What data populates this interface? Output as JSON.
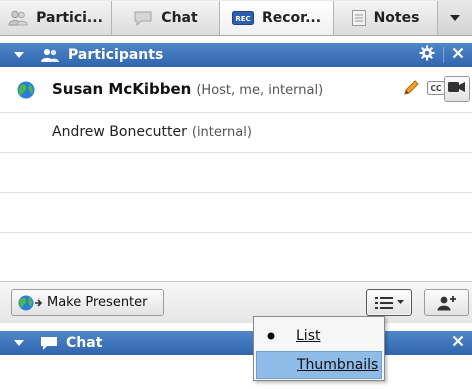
{
  "tabs": [
    {
      "label": "Partici...",
      "icon": "participants-icon"
    },
    {
      "label": "Chat",
      "icon": "chat-icon"
    },
    {
      "label": "Recor...",
      "icon": "record-icon"
    },
    {
      "label": "Notes",
      "icon": "notes-icon"
    }
  ],
  "participants_panel": {
    "title": "Participants"
  },
  "participants": [
    {
      "name": "Susan McKibben",
      "role": "(Host, me, internal)",
      "presenter": true
    },
    {
      "name": "Andrew Bonecutter",
      "role": "(internal)",
      "presenter": false
    }
  ],
  "toolbar": {
    "make_presenter_label": "Make Presenter"
  },
  "chat_panel": {
    "title": "Chat"
  },
  "view_menu": {
    "items": [
      {
        "label": "List",
        "checked": true
      },
      {
        "label": "Thumbnails",
        "checked": false,
        "highlighted": true
      }
    ]
  },
  "colors": {
    "header_blue": "#3a72b8",
    "highlight": "#8fbbe8"
  }
}
